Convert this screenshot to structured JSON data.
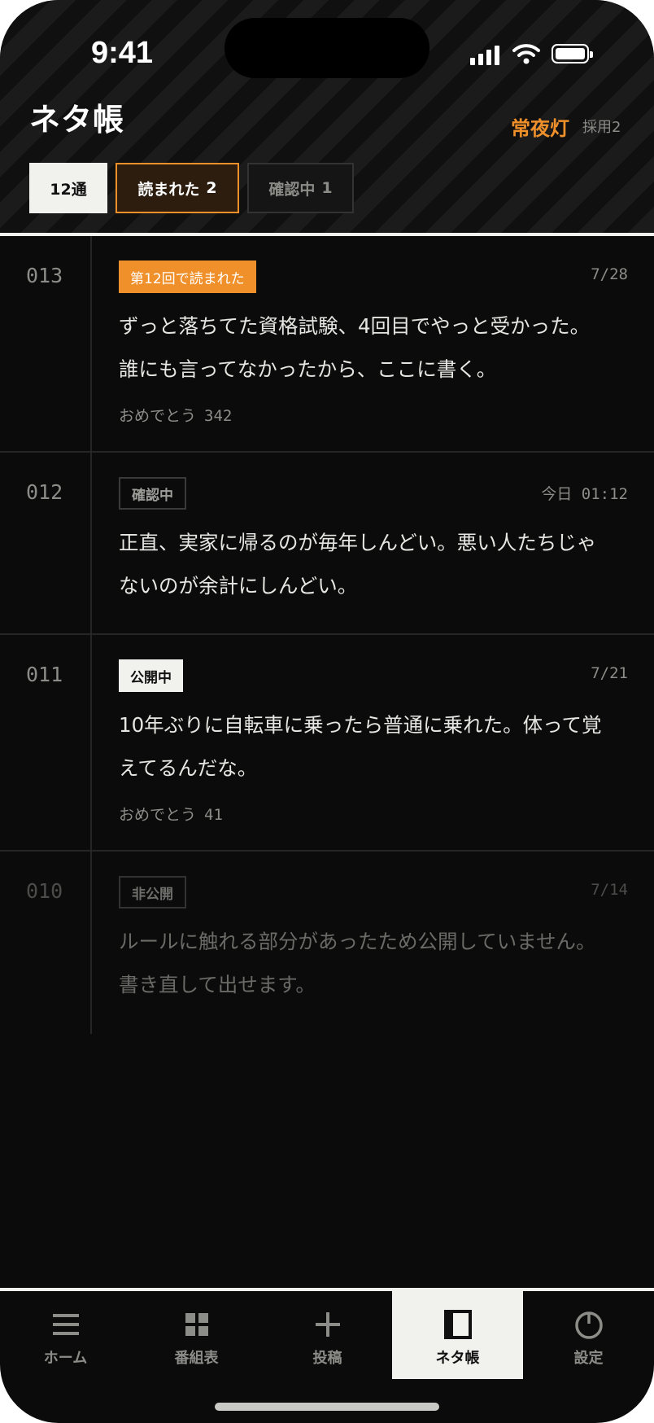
{
  "status_bar": {
    "time": "9:41"
  },
  "header": {
    "title": "ネタ帳",
    "brand": "常夜灯",
    "adopted": "採用2",
    "filters": [
      {
        "label": "12通",
        "count": ""
      },
      {
        "label": "読まれた",
        "count": "2"
      },
      {
        "label": "確認中",
        "count": "1"
      }
    ]
  },
  "entries": [
    {
      "number": "013",
      "badge": "第12回で読まれた",
      "date": "7/28",
      "text_line1": "ずっと落ちてた資格試験、4回目でやっと受かった。",
      "text_line2": "誰にも言ってなかったから、ここに書く。",
      "reaction_label": "おめでとう",
      "reaction_count": "342"
    },
    {
      "number": "012",
      "badge": "確認中",
      "date": "今日 01:12",
      "text_line1": "正直、実家に帰るのが毎年しんどい。悪い人たちじゃ",
      "text_line2": "ないのが余計にしんどい。"
    },
    {
      "number": "011",
      "badge": "公開中",
      "date": "7/21",
      "text_line1": "10年ぶりに自転車に乗ったら普通に乗れた。体って覚",
      "text_line2": "えてるんだな。",
      "reaction_label": "おめでとう",
      "reaction_count": "41"
    },
    {
      "number": "010",
      "badge": "非公開",
      "date": "7/14",
      "text_line1": "ルールに触れる部分があったため公開していません。",
      "text_line2": "書き直して出せます。"
    }
  ],
  "tabbar": {
    "items": [
      {
        "label": "ホーム",
        "icon": "menu-icon"
      },
      {
        "label": "番組表",
        "icon": "grid-icon"
      },
      {
        "label": "投稿",
        "icon": "plus-icon"
      },
      {
        "label": "ネタ帳",
        "icon": "notebook-icon"
      },
      {
        "label": "設定",
        "icon": "power-icon"
      }
    ],
    "active": "ネタ帳"
  },
  "colors": {
    "accent": "#f0902a",
    "background": "#0b0b0b",
    "paper": "#f1f1ee"
  }
}
